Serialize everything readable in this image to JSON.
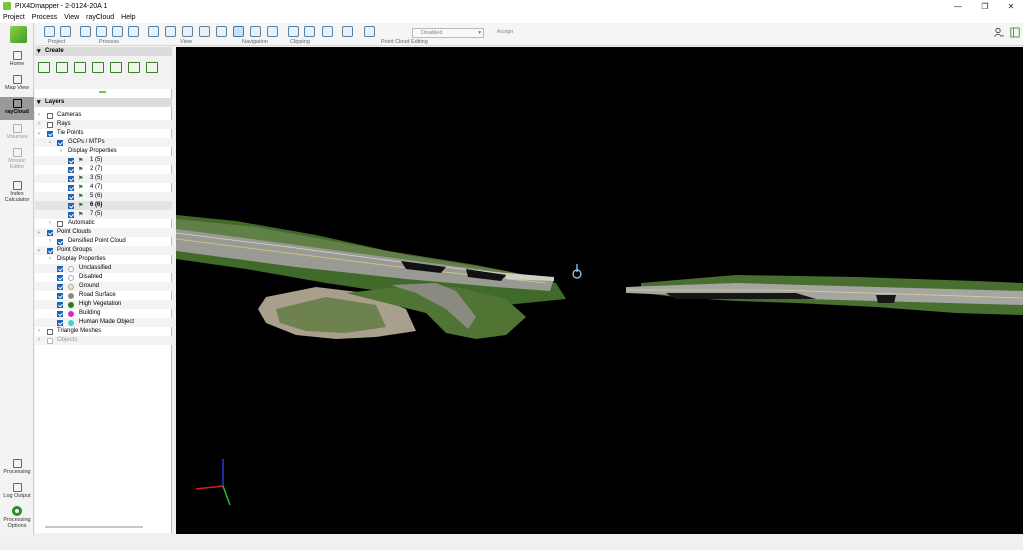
{
  "window": {
    "title": "PIX4Dmapper - 2-0124-20A 1",
    "controls": [
      "—",
      "❐",
      "✕"
    ]
  },
  "menu": [
    "Project",
    "Process",
    "View",
    "rayCloud",
    "Help"
  ],
  "toolbar": {
    "groups": [
      "Project",
      "Process",
      "View",
      "Navigation",
      "Clipping",
      "Point Cloud Editing"
    ],
    "classification_combo": "Disabled",
    "assign_label": "Assign"
  },
  "leftnav": {
    "items": [
      {
        "label": "Home",
        "icon": "home-icon"
      },
      {
        "label": "Map View",
        "icon": "map-icon"
      },
      {
        "label": "rayCloud",
        "icon": "raycloud-icon"
      },
      {
        "label": "Volumes",
        "icon": "volumes-icon"
      },
      {
        "label": "Mosaic Editor",
        "icon": "mosaic-icon"
      },
      {
        "label": "Index Calculator",
        "icon": "index-icon"
      }
    ],
    "bottom_items": [
      {
        "label": "Processing",
        "icon": "processing-icon"
      },
      {
        "label": "Log Output",
        "icon": "log-icon"
      },
      {
        "label": "Processing Options",
        "icon": "gear-icon"
      }
    ]
  },
  "panel": {
    "create_header": "Create",
    "layers_header": "Layers",
    "tree": [
      {
        "label": "Cameras",
        "checked": false
      },
      {
        "label": "Rays",
        "checked": false
      },
      {
        "label": "Tie Points",
        "checked": true
      },
      {
        "label": "GCPs / MTPs",
        "checked": true
      },
      {
        "label": "Display Properties"
      },
      {
        "label": "1 (5)",
        "checked": true
      },
      {
        "label": "2 (7)",
        "checked": true
      },
      {
        "label": "3 (5)",
        "checked": true
      },
      {
        "label": "4 (7)",
        "checked": true
      },
      {
        "label": "5 (6)",
        "checked": true
      },
      {
        "label": "6 (6)",
        "checked": true
      },
      {
        "label": "7 (5)",
        "checked": true
      },
      {
        "label": "Automatic",
        "checked": false
      },
      {
        "label": "Point Clouds",
        "checked": true
      },
      {
        "label": "Densified Point Cloud",
        "checked": true
      },
      {
        "label": "Point Groups",
        "checked": true
      },
      {
        "label": "Display Properties"
      },
      {
        "label": "Unclassified",
        "checked": true,
        "color": "#ffffff"
      },
      {
        "label": "Disabled",
        "checked": true,
        "color": "#ffffff"
      },
      {
        "label": "Ground",
        "checked": true,
        "color": "#f5e6b0"
      },
      {
        "label": "Road Surface",
        "checked": true,
        "color": "#888888"
      },
      {
        "label": "High Vegetation",
        "checked": true,
        "color": "#2f7a1f"
      },
      {
        "label": "Building",
        "checked": true,
        "color": "#d629c8"
      },
      {
        "label": "Human Made Object",
        "checked": true,
        "color": "#3fd0d8"
      },
      {
        "label": "Triangle Meshes",
        "checked": false
      },
      {
        "label": "Objects",
        "checked": false
      }
    ]
  },
  "colors": {
    "accent_green": "#7bc142",
    "checkbox_blue": "#1f64b4",
    "viewport_bg": "#000000"
  }
}
